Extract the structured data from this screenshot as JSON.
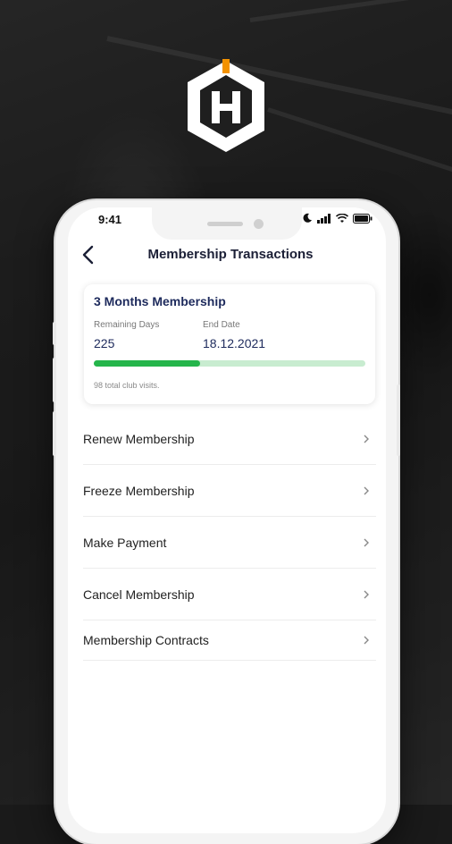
{
  "status_bar": {
    "time": "9:41"
  },
  "header": {
    "title": "Membership Transactions"
  },
  "membership_card": {
    "title": "3 Months Membership",
    "remaining_days_label": "Remaining Days",
    "remaining_days_value": "225",
    "end_date_label": "End Date",
    "end_date_value": "18.12.2021",
    "progress": 0.39,
    "visits_text": "98 total club visits.",
    "colors": {
      "progress_fill": "#25b54b",
      "progress_track": "#c8ecd0",
      "title": "#1d2a5c"
    }
  },
  "menu": {
    "items": [
      {
        "label": "Renew Membership",
        "icon": "chevron-right-icon"
      },
      {
        "label": "Freeze Membership",
        "icon": "chevron-right-icon"
      },
      {
        "label": "Make Payment",
        "icon": "chevron-right-icon"
      },
      {
        "label": "Cancel Membership",
        "icon": "chevron-right-icon"
      },
      {
        "label": "Membership Contracts",
        "icon": "chevron-right-icon"
      }
    ]
  },
  "brand": {
    "logo_icon": "hexagon-h-logo-icon",
    "accent": "#f39200"
  }
}
